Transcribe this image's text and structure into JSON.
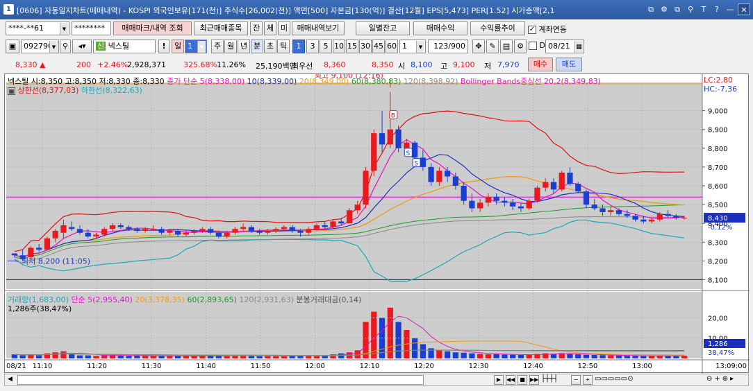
{
  "window": {
    "app_icon": "1",
    "title": "[0606] 자동일지차트(매매내역) - KOSPI 외국인보유[171(천)] 주식수[26,002(천)] 액면[500] 자본금[130(억)] 결산[12월] EPS[5,473] PER[1.52] 시가총액[2,1",
    "buttons": [
      "⧉",
      "⚙",
      "⧉",
      "⚲",
      "T",
      "?",
      "—",
      "✕"
    ]
  },
  "toolbar1": {
    "account": "****-**61",
    "password": "********",
    "btn_mark": "매매마크/내역 조회",
    "btn_recent": "최근매매종목",
    "btn_jan": "잔",
    "btn_che": "체",
    "btn_mi": "미",
    "btn_history": "매매내역보기",
    "btn_daily_balance": "일별잔고",
    "btn_profit": "매매수익",
    "btn_return": "수익률추이",
    "chk_link_label": "계좌연동",
    "chk_link": true
  },
  "toolbar2": {
    "code": "092790",
    "badge": "신",
    "name": "넥스틸",
    "period_day": "일",
    "period_day_num": "1",
    "periods": [
      "주",
      "월",
      "년",
      "분",
      "초",
      "틱"
    ],
    "active_period": "분",
    "minute_buttons": [
      "1",
      "3",
      "5",
      "10",
      "15",
      "30",
      "45",
      "60"
    ],
    "active_minute": "1",
    "count_select": "1",
    "count": "123/900",
    "date_check_label": "D",
    "date": "08/21"
  },
  "quote": {
    "price": "8,330",
    "arrow": "▲",
    "change": "200",
    "change_rate": "+2.46%",
    "volume": "2,928,371",
    "vol_ratio": "325.68%",
    "turnover": "11.26%",
    "amount": "25,190백만",
    "best_label": "최우선",
    "best_ask": "8,360",
    "best_bid": "8,350",
    "open_label": "시",
    "open": "8,100",
    "high_label": "고",
    "high": "9,100",
    "low_label": "저",
    "low": "7,970",
    "buy_label": "매수",
    "sell_label": "매도"
  },
  "legend": {
    "ohlc": "넥스틸 시:8,350 고:8,350 저:8,330 종:8,330",
    "ma5": "종가 단순 5(8,338,00)",
    "ma10": "10(8,339,00)",
    "ma20": "20(8,349,00)",
    "ma60": "60(8,380,83)",
    "ma120": "120(8,398,92)",
    "bb": "Bollinger Bands중심선 20,2(8,349,83)",
    "bb_upper": "상한선(8,377,03)",
    "bb_lower": "하한선(8,322,63)",
    "lc": "LC:2,80",
    "hc": "HC:-7,36",
    "high_marker": "최고 9,100 (12:16)",
    "low_marker": "최저 8,200 (11:05)",
    "last_price": "8,430",
    "last_change": "-0.12%",
    "vol_legend": "거래량(1,683,00)",
    "vol_ma5": "단순 5(2,955,40)",
    "vol_ma20": "20(3,378,35)",
    "vol_ma60": "60(2,893,65)",
    "vol_ma120": "120(2,931,63)",
    "vol_amount": "분봉거래대금(0,14)",
    "vol_current": "1,286주(38,47%)",
    "vol_last": "1,286",
    "vol_last_pct": "38,47%",
    "date_label": "08/21",
    "end_time": "13:09:00"
  },
  "colors": {
    "up": "#e8191f",
    "down": "#1a3fd0",
    "bb_upper": "#dd1111",
    "bb_lower": "#19a7b8",
    "ma5": "#e612c8",
    "ma10": "#1a2fbf",
    "ma20": "#f09a12",
    "ma60": "#1b9a2a",
    "ma120": "#888888",
    "hline": "#e01fd6"
  },
  "chart_data": {
    "type": "line",
    "title": "",
    "ylim": [
      8050,
      9150
    ],
    "y_ticks": [
      "9,000",
      "8,900",
      "8,800",
      "8,700",
      "8,600",
      "8,500",
      "8,400",
      "8,300",
      "8,200",
      "8,100"
    ],
    "x_ticks": [
      "11:10",
      "11:20",
      "11:30",
      "11:40",
      "11:50",
      "12:00",
      "12:10",
      "12:20",
      "12:30",
      "12:40",
      "12:50",
      "13:00"
    ],
    "vol_ticks": [
      "20,00",
      "10,00"
    ],
    "high": {
      "time": "12:16",
      "value": 9100
    },
    "low": {
      "time": "11:05",
      "value": 8200
    },
    "reference_line": 8540,
    "bottom_line": 8100,
    "candles": [
      [
        8240,
        8240,
        8220,
        8230
      ],
      [
        8230,
        8260,
        8200,
        8210
      ],
      [
        8220,
        8280,
        8210,
        8270
      ],
      [
        8270,
        8290,
        8250,
        8260
      ],
      [
        8260,
        8330,
        8260,
        8320
      ],
      [
        8320,
        8370,
        8300,
        8360
      ],
      [
        8350,
        8420,
        8320,
        8390
      ],
      [
        8380,
        8410,
        8360,
        8370
      ],
      [
        8370,
        8390,
        8340,
        8350
      ],
      [
        8350,
        8370,
        8320,
        8330
      ],
      [
        8330,
        8350,
        8320,
        8340
      ],
      [
        8340,
        8380,
        8330,
        8370
      ],
      [
        8370,
        8400,
        8360,
        8390
      ],
      [
        8390,
        8400,
        8370,
        8380
      ],
      [
        8380,
        8390,
        8360,
        8370
      ],
      [
        8370,
        8380,
        8350,
        8360
      ],
      [
        8360,
        8380,
        8350,
        8370
      ],
      [
        8370,
        8390,
        8360,
        8370
      ],
      [
        8370,
        8380,
        8340,
        8350
      ],
      [
        8350,
        8370,
        8340,
        8360
      ],
      [
        8360,
        8370,
        8330,
        8340
      ],
      [
        8340,
        8360,
        8330,
        8350
      ],
      [
        8350,
        8370,
        8340,
        8360
      ],
      [
        8360,
        8380,
        8350,
        8370
      ],
      [
        8370,
        8380,
        8340,
        8350
      ],
      [
        8350,
        8360,
        8320,
        8330
      ],
      [
        8330,
        8360,
        8320,
        8350
      ],
      [
        8350,
        8380,
        8340,
        8370
      ],
      [
        8370,
        8400,
        8360,
        8380
      ],
      [
        8380,
        8390,
        8350,
        8360
      ],
      [
        8360,
        8370,
        8340,
        8350
      ],
      [
        8350,
        8370,
        8340,
        8360
      ],
      [
        8360,
        8380,
        8350,
        8370
      ],
      [
        8370,
        8390,
        8360,
        8380
      ],
      [
        8380,
        8390,
        8350,
        8360
      ],
      [
        8360,
        8370,
        8330,
        8350
      ],
      [
        8350,
        8380,
        8340,
        8370
      ],
      [
        8370,
        8400,
        8360,
        8390
      ],
      [
        8390,
        8410,
        8370,
        8380
      ],
      [
        8380,
        8420,
        8370,
        8410
      ],
      [
        8410,
        8430,
        8390,
        8400
      ],
      [
        8400,
        8480,
        8400,
        8470
      ],
      [
        8470,
        8520,
        8450,
        8500
      ],
      [
        8500,
        8700,
        8480,
        8680
      ],
      [
        8680,
        8900,
        8650,
        8880
      ],
      [
        8880,
        9000,
        8780,
        8820
      ],
      [
        8820,
        9100,
        8800,
        8900
      ],
      [
        8900,
        8920,
        8780,
        8800
      ],
      [
        8800,
        8850,
        8760,
        8830
      ],
      [
        8830,
        8840,
        8730,
        8750
      ],
      [
        8750,
        8790,
        8680,
        8700
      ],
      [
        8700,
        8720,
        8600,
        8620
      ],
      [
        8620,
        8700,
        8600,
        8680
      ],
      [
        8680,
        8700,
        8620,
        8650
      ],
      [
        8650,
        8670,
        8580,
        8600
      ],
      [
        8600,
        8620,
        8500,
        8520
      ],
      [
        8520,
        8560,
        8460,
        8480
      ],
      [
        8480,
        8530,
        8460,
        8510
      ],
      [
        8510,
        8560,
        8490,
        8540
      ],
      [
        8540,
        8560,
        8500,
        8520
      ],
      [
        8520,
        8540,
        8490,
        8510
      ],
      [
        8510,
        8530,
        8470,
        8490
      ],
      [
        8490,
        8510,
        8460,
        8480
      ],
      [
        8480,
        8530,
        8470,
        8520
      ],
      [
        8520,
        8600,
        8510,
        8590
      ],
      [
        8590,
        8640,
        8570,
        8620
      ],
      [
        8620,
        8640,
        8560,
        8580
      ],
      [
        8580,
        8680,
        8570,
        8670
      ],
      [
        8670,
        8700,
        8600,
        8610
      ],
      [
        8610,
        8620,
        8560,
        8570
      ],
      [
        8570,
        8580,
        8480,
        8500
      ],
      [
        8500,
        8530,
        8470,
        8480
      ],
      [
        8480,
        8500,
        8440,
        8460
      ],
      [
        8460,
        8490,
        8440,
        8470
      ],
      [
        8470,
        8480,
        8440,
        8450
      ],
      [
        8450,
        8470,
        8430,
        8440
      ],
      [
        8440,
        8450,
        8410,
        8420
      ],
      [
        8420,
        8440,
        8400,
        8410
      ],
      [
        8410,
        8430,
        8400,
        8420
      ],
      [
        8420,
        8460,
        8410,
        8450
      ],
      [
        8450,
        8470,
        8430,
        8440
      ],
      [
        8440,
        8450,
        8420,
        8430
      ],
      [
        8430,
        8440,
        8420,
        8430
      ]
    ],
    "volumes": [
      2,
      1.5,
      2,
      1.5,
      2.5,
      3,
      3.5,
      2,
      1.5,
      1.5,
      1.2,
      1.5,
      1.8,
      1.4,
      1.2,
      1.3,
      1.2,
      1.4,
      1.3,
      1.2,
      1.3,
      1.2,
      1.1,
      1.3,
      1.2,
      1.4,
      1.5,
      1.6,
      1.4,
      1.2,
      1.1,
      1.3,
      1.2,
      1.4,
      1.3,
      1.2,
      1.5,
      1.7,
      1.6,
      2,
      2.5,
      3,
      4,
      18,
      23,
      20,
      25,
      18,
      14,
      10,
      7,
      5,
      4,
      3.5,
      3,
      2.8,
      2.5,
      2.2,
      2,
      2.1,
      1.9,
      1.8,
      1.7,
      1.8,
      2.2,
      2.5,
      2.3,
      2.6,
      2.2,
      2,
      1.8,
      1.7,
      1.6,
      1.5,
      1.4,
      1.3,
      1.2,
      1.3,
      1.2,
      1.4,
      1.3,
      1.2,
      1.3
    ]
  }
}
